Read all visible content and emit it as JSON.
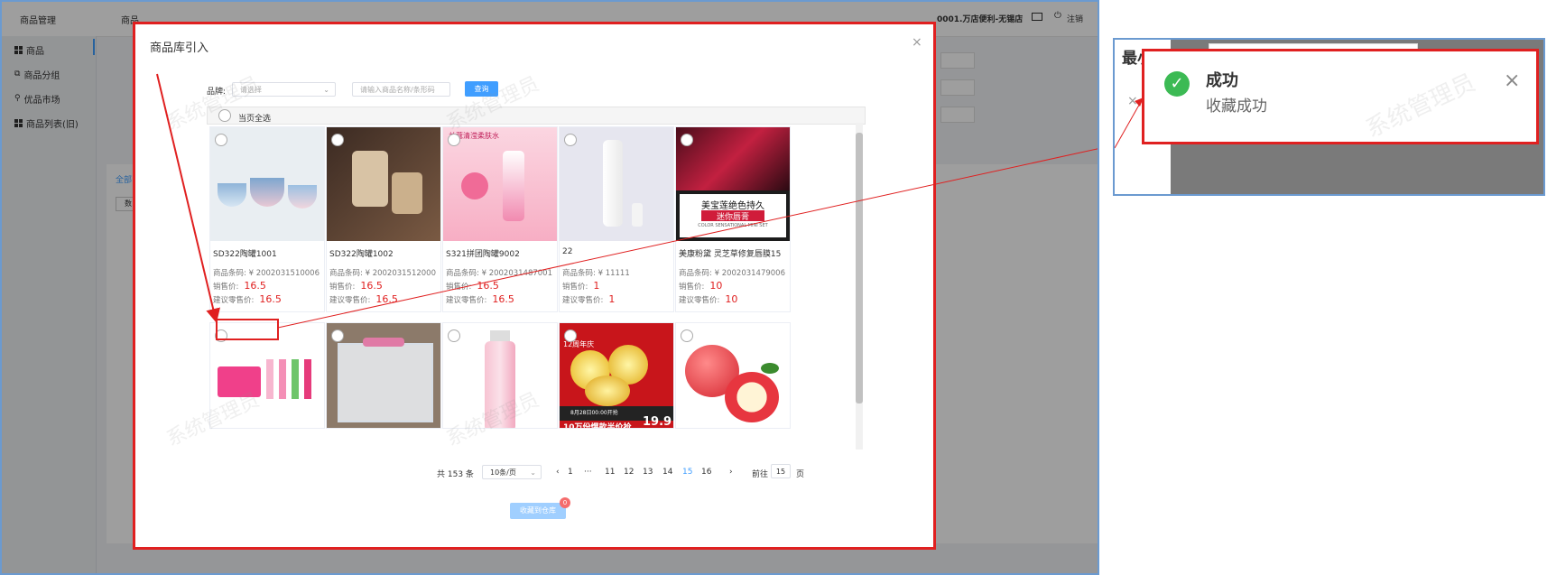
{
  "app": {
    "title": "商品管理",
    "breadcrumb": "商品",
    "store": "0001.万店便利-无锡店",
    "logout": "注销",
    "sidebar": [
      "商品",
      "商品分组",
      "优品市场",
      "商品列表(旧)"
    ],
    "tabs": [
      "全部"
    ],
    "side_btn": "数"
  },
  "modal": {
    "title": "商品库引入",
    "brand_label": "品牌:",
    "brand_placeholder": "请选择",
    "search_placeholder": "请输入商品名称/条形码",
    "query": "查询",
    "select_all": "当页全选",
    "code_label": "商品条码: ",
    "price_label": "销售价:",
    "retail_label": "建议零售价:",
    "fav_label": "收藏到仓库",
    "products": [
      {
        "name": "SD322陶罐1001",
        "code": "¥ 2002031510006",
        "price": "16.5",
        "retail": "16.5",
        "img": "bowls"
      },
      {
        "name": "SD322陶罐1002",
        "code": "¥ 2002031512000",
        "price": "16.5",
        "retail": "16.5",
        "img": "pottery"
      },
      {
        "name": "S321拼团陶罐9002",
        "code": "¥ 2002031487001",
        "price": "16.5",
        "retail": "16.5",
        "img": "toner"
      },
      {
        "name": "22",
        "code": "¥ 11111",
        "price": "1",
        "retail": "1",
        "img": "bottle"
      },
      {
        "name": "美康粉黛 灵芝草修复唇膜15",
        "code": "¥ 2002031479006",
        "price": "10",
        "retail": "10",
        "img": "lipstick"
      },
      {
        "img": "handcream"
      },
      {
        "img": "box"
      },
      {
        "img": "lancome"
      },
      {
        "img": "kiwi"
      },
      {
        "img": "apple"
      }
    ],
    "lipstick_text1": "美宝莲绝色持久",
    "lipstick_text2": "迷你唇膏",
    "lipstick_text3": "COLOR SENSATIONAL MINI SET",
    "toner_text": "兰蔻清滢柔肤水",
    "kiwi_badge": "12周年庆",
    "kiwi_text": "10万份爆款半价抢",
    "kiwi_price": "19.9",
    "kiwi_date": "8月28日00:00开抢",
    "pagination": {
      "total": "共 153 条",
      "per_page": "10条/页",
      "pages": [
        "1",
        "···",
        "11",
        "12",
        "13",
        "14",
        "15",
        "16"
      ],
      "current": "15",
      "goto_label": "前往",
      "goto_value": "15",
      "goto_unit": "页"
    },
    "fav_all": "收藏到仓库",
    "badge": "0"
  },
  "watermark": "系统管理员",
  "zoom": {
    "header_text": "最小价格",
    "toast_title": "成功",
    "toast_msg": "收藏成功"
  }
}
